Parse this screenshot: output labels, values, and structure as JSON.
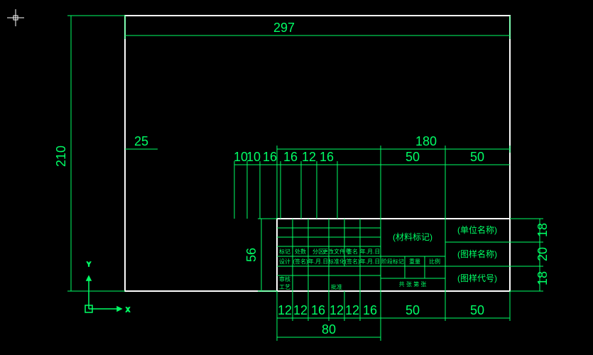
{
  "dimensions": {
    "width": "297",
    "height": "210",
    "margin_left": "25",
    "title_block_width": "180",
    "title_block_height": "56",
    "top_cols": [
      "10",
      "10",
      "16",
      "16",
      "12",
      "16",
      "50",
      "50"
    ],
    "bot_cols": [
      "12",
      "12",
      "16",
      "12",
      "12",
      "16",
      "50",
      "50"
    ],
    "bot_span": "80",
    "right_rows": [
      "18",
      "20",
      "18"
    ]
  },
  "labels": {
    "material": "(材料标记)",
    "company": "(单位名称)",
    "drawing_name": "(图样名称)",
    "drawing_no": "(图样代号)",
    "stage": "阶段标记",
    "weight": "重量",
    "scale": "比例",
    "sheets": "共   张  第   张"
  },
  "headers": {
    "r1c1": "标记",
    "r1c2": "处数",
    "r1c3": "分区",
    "r1c4": "更改文件号",
    "r1c5": "签名",
    "r1c6": "年.月.日",
    "r2c1": "设计",
    "r2c2": "(签名)",
    "r2c3": "年.月.日",
    "r2c4": "标准化",
    "r2c5": "(签名)",
    "r2c6": "年.月.日",
    "r3c1": "审核",
    "r4c1": "工艺",
    "r4c4": "批准"
  }
}
